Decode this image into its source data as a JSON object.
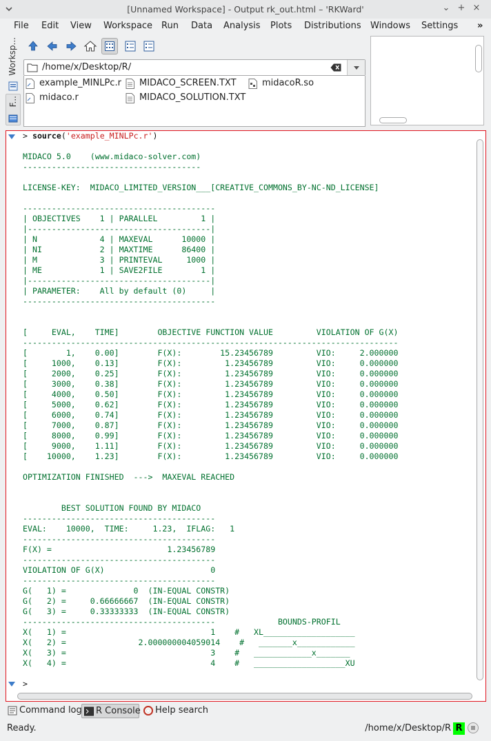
{
  "window": {
    "title": "[Unnamed Workspace] - Output rk_out.html – 'RKWard'"
  },
  "menu": [
    "File",
    "Edit",
    "View",
    "Workspace",
    "Run",
    "Data",
    "Analysis",
    "Plots",
    "Distributions",
    "Windows",
    "Settings"
  ],
  "menu_more": "»",
  "dock": {
    "workspace_tab": "Worksp...",
    "files_tab": "F..."
  },
  "file_browser": {
    "path": "/home/x/Desktop/R/",
    "files": [
      "example_MINLPc.r",
      "midaco.r",
      "MIDACO_SCREEN.TXT",
      "MIDACO_SOLUTION.TXT",
      "midacoR.so"
    ]
  },
  "console": {
    "command_keyword": "source",
    "command_open": "(",
    "command_arg": "'example_MINLPc.r'",
    "command_close": ")",
    "output": "\nMIDACO 5.0    (www.midaco-solver.com)\n-------------------------------------\n\nLICENSE-KEY:  MIDACO_LIMITED_VERSION___[CREATIVE_COMMONS_BY-NC-ND_LICENSE]\n\n----------------------------------------\n| OBJECTIVES    1 | PARALLEL         1 |\n|--------------------------------------|\n| N             4 | MAXEVAL      10000 |\n| NI            2 | MAXTIME      86400 |\n| M             3 | PRINTEVAL     1000 |\n| ME            1 | SAVE2FILE        1 |\n|--------------------------------------|\n| PARAMETER:    All by default (0)     |\n----------------------------------------\n\n\n[     EVAL,    TIME]        OBJECTIVE FUNCTION VALUE         VIOLATION OF G(X)\n------------------------------------------------------------------------------\n[        1,    0.00]        F(X):        15.23456789         VIO:     2.000000\n[     1000,    0.13]        F(X):         1.23456789         VIO:     0.000000\n[     2000,    0.25]        F(X):         1.23456789         VIO:     0.000000\n[     3000,    0.38]        F(X):         1.23456789         VIO:     0.000000\n[     4000,    0.50]        F(X):         1.23456789         VIO:     0.000000\n[     5000,    0.62]        F(X):         1.23456789         VIO:     0.000000\n[     6000,    0.74]        F(X):         1.23456789         VIO:     0.000000\n[     7000,    0.87]        F(X):         1.23456789         VIO:     0.000000\n[     8000,    0.99]        F(X):         1.23456789         VIO:     0.000000\n[     9000,    1.11]        F(X):         1.23456789         VIO:     0.000000\n[    10000,    1.23]        F(X):         1.23456789         VIO:     0.000000\n\nOPTIMIZATION FINISHED  --->  MAXEVAL REACHED\n\n\n        BEST SOLUTION FOUND BY MIDACO\n----------------------------------------\nEVAL:    10000,  TIME:     1.23,  IFLAG:   1\n----------------------------------------\nF(X) =                        1.23456789\n----------------------------------------\nVIOLATION OF G(X)                      0\n----------------------------------------\nG(   1) =              0  (IN-EQUAL CONSTR)\nG(   2) =     0.66666667  (IN-EQUAL CONSTR)\nG(   3) =     0.33333333  (IN-EQUAL CONSTR)\n----------------------------------------             BOUNDS-PROFIL\nX(   1) =                              1    #   XL___________________\nX(   2) =               2.000000004059014    #   _______x____________\nX(   3) =                              3    #   ____________x_______\nX(   4) =                              4    #   ___________________XU\n\n",
    "prompt": ">"
  },
  "bottom_tabs": [
    "Command log",
    "R Console",
    "Help search"
  ],
  "status": {
    "left": "Ready.",
    "path": "/home/x/Desktop/R",
    "badge": "R"
  }
}
